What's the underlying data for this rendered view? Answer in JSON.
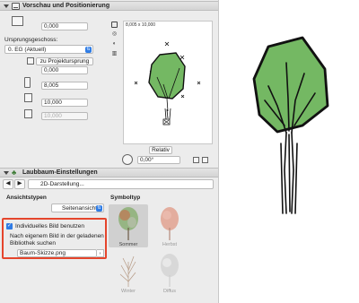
{
  "section1": {
    "title": "Vorschau und Positionierung"
  },
  "position": {
    "height_value": "0,000",
    "base_story_label": "Ursprungsgeschoss:",
    "base_story_value": "0. EG (Aktuell)",
    "to_project_origin_label": "zu Projektursprung",
    "offset_value": "0,000",
    "width_value": "8,005",
    "depth_value": "10,000",
    "height2_value": "10,000"
  },
  "preview": {
    "size_tag": "8,005 x 10,000",
    "mode_label": "Relativ",
    "angle_value": "0,00°"
  },
  "section2": {
    "title": "Laubbaum-Einstellungen"
  },
  "nav": {
    "section_label": "2D-Darstellung..."
  },
  "views": {
    "heading": "Ansichtstypen",
    "selected": "Seitenansicht"
  },
  "custom_image": {
    "checkbox_label": "Individuelles Bild benutzen",
    "help_text": "Nach eigenem Bild in der geladenen Bibliothek suchen",
    "file_name": "Baum-Skizze.png",
    "highlight_color": "#e5452c"
  },
  "symbol_type": {
    "heading": "Symboltyp",
    "items": [
      {
        "label": "Sommer",
        "selected": true
      },
      {
        "label": "Herbst",
        "selected": false
      },
      {
        "label": "Winter",
        "selected": false
      },
      {
        "label": "Diffus",
        "selected": false
      }
    ]
  },
  "colors": {
    "leaf_green": "#74b863",
    "autumn": "#e2a291",
    "accent_blue": "#2f7ce5"
  }
}
